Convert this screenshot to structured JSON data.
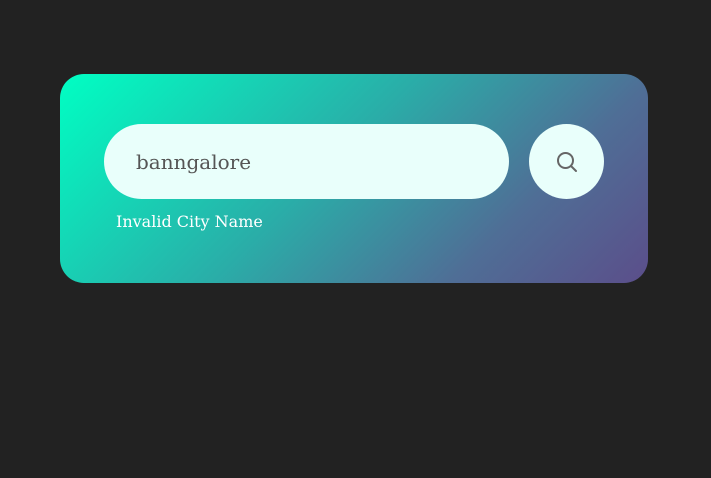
{
  "search": {
    "value": "banngalore",
    "button_icon": "search-icon",
    "error_message": "Invalid City Name"
  },
  "colors": {
    "background": "#222222",
    "card_gradient_start": "#00ffc3",
    "card_gradient_end": "#5b4e8a",
    "input_background": "#e9fffb",
    "icon_color": "#666666"
  }
}
